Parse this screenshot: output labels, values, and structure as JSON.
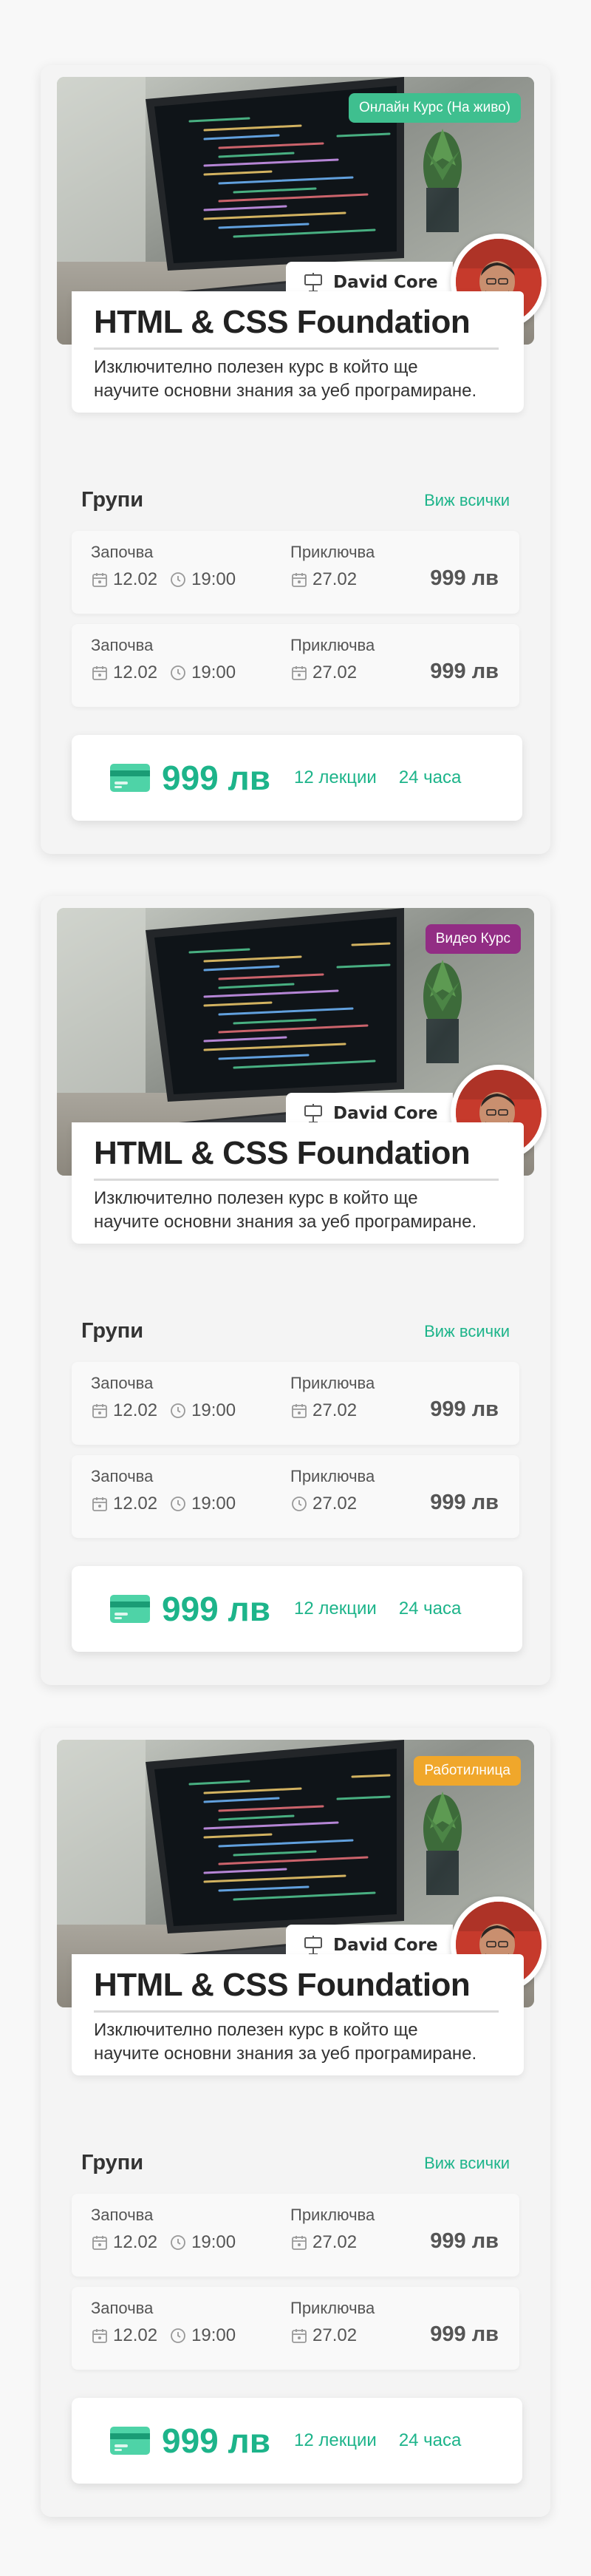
{
  "colors": {
    "accent": "#1db48a",
    "badge_live": "#3fbf8f",
    "badge_video": "#922d84",
    "badge_workshop": "#f0a72b"
  },
  "icons": {
    "author": "teacher-board-icon",
    "date": "calendar-icon",
    "time": "clock-icon",
    "payment": "credit-card-icon"
  },
  "cards": [
    {
      "badge": "Онлайн Курс (На живо)",
      "author": "David Core",
      "title": "HTML & CSS Foundation",
      "description": "Изключително полезен курс в който ще научите основни знания за уеб програмиране.",
      "groups_title": "Групи",
      "see_all": "Виж всички",
      "groups": [
        {
          "start_label": "Започва",
          "start_date": "12.02",
          "start_time": "19:00",
          "end_label": "Приключва",
          "end_date": "27.02",
          "price": "999 лв"
        },
        {
          "start_label": "Започва",
          "start_date": "12.02",
          "start_time": "19:00",
          "end_label": "Приключва",
          "end_date": "27.02",
          "price": "999 лв"
        }
      ],
      "price": "999 лв",
      "lectures": "12 лекции",
      "hours": "24 часа"
    },
    {
      "badge": "Видео Курс",
      "author": "David Core",
      "title": "HTML & CSS Foundation",
      "description": "Изключително полезен курс в който ще научите основни знания за уеб програмиране.",
      "groups_title": "Групи",
      "see_all": "Виж всички",
      "groups": [
        {
          "start_label": "Започва",
          "start_date": "12.02",
          "start_time": "19:00",
          "end_label": "Приключва",
          "end_date": "27.02",
          "price": "999 лв"
        },
        {
          "start_label": "Започва",
          "start_date": "12.02",
          "start_time": "19:00",
          "end_label": "Приключва",
          "end_date": "27.02",
          "price": "999 лв"
        }
      ],
      "price": "999 лв",
      "lectures": "12 лекции",
      "hours": "24 часа"
    },
    {
      "badge": "Работилница",
      "author": "David Core",
      "title": "HTML & CSS Foundation",
      "description": "Изключително полезен курс в който ще научите основни знания за уеб програмиране.",
      "groups_title": "Групи",
      "see_all": "Виж всички",
      "groups": [
        {
          "start_label": "Започва",
          "start_date": "12.02",
          "start_time": "19:00",
          "end_label": "Приключва",
          "end_date": "27.02",
          "price": "999 лв"
        },
        {
          "start_label": "Започва",
          "start_date": "12.02",
          "start_time": "19:00",
          "end_label": "Приключва",
          "end_date": "27.02",
          "price": "999 лв"
        }
      ],
      "price": "999 лв",
      "lectures": "12 лекции",
      "hours": "24 часа"
    }
  ]
}
